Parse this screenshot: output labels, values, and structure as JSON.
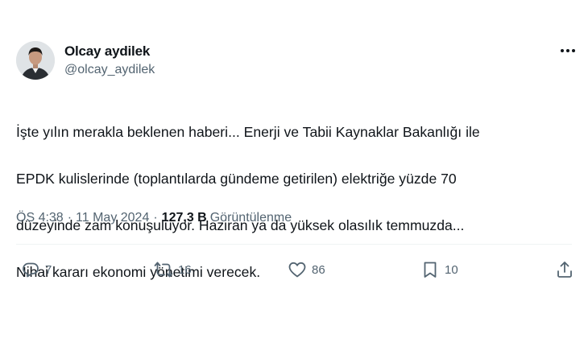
{
  "author": {
    "display_name": "Olcay aydilek",
    "handle": "@olcay_aydilek",
    "avatar_icon": "profile-photo"
  },
  "tweet": {
    "lines": [
      "İşte yılın merakla beklenen haberi... Enerji ve Tabii Kaynaklar Bakanlığı ile",
      "EPDK kulislerinde (toplantılarda gündeme getirilen) elektriğe yüzde 70",
      "düzeyinde zam konuşuluyor. Haziran ya da yüksek olasılık temmuzda...",
      "Nihai kararı ekonomi yönetimi verecek."
    ]
  },
  "meta": {
    "time": "ÖS 4:38",
    "date": "11 May 2024",
    "separator": "·",
    "views_count": "127,3 B",
    "views_label": "Görüntülenme"
  },
  "actions": {
    "replies": "7",
    "reposts": "16",
    "likes": "86",
    "bookmarks": "10"
  },
  "colors": {
    "text_primary": "#0f1419",
    "text_secondary": "#536471",
    "divider": "#eff3f4"
  }
}
